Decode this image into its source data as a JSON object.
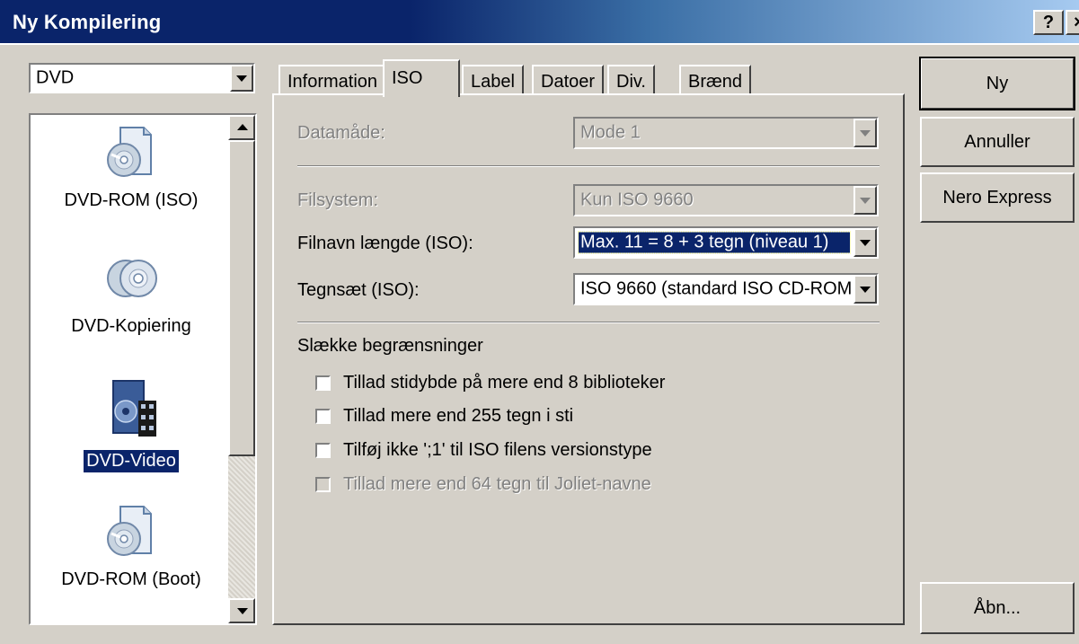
{
  "window": {
    "title": "Ny Kompilering",
    "help_button": "?",
    "close_button": "×"
  },
  "media_select": {
    "value": "DVD"
  },
  "compilation_list": {
    "items": [
      {
        "label": "DVD-ROM (ISO)",
        "icon": "dvd-rom-iso-icon",
        "selected": false
      },
      {
        "label": "DVD-Kopiering",
        "icon": "dvd-copy-icon",
        "selected": false
      },
      {
        "label": "DVD-Video",
        "icon": "dvd-video-icon",
        "selected": true
      },
      {
        "label": "DVD-ROM (Boot)",
        "icon": "dvd-rom-boot-icon",
        "selected": false
      }
    ]
  },
  "tabs": [
    {
      "label": "Information",
      "active": false
    },
    {
      "label": "ISO",
      "active": true
    },
    {
      "label": "Label",
      "active": false
    },
    {
      "label": "Datoer",
      "active": false
    },
    {
      "label": "Div.",
      "active": false
    },
    {
      "label": "Brænd",
      "active": false
    }
  ],
  "iso": {
    "data_mode": {
      "label": "Datamåde:",
      "value": "Mode 1",
      "enabled": false
    },
    "filesystem": {
      "label": "Filsystem:",
      "value": "Kun ISO 9660",
      "enabled": false
    },
    "filename_length": {
      "label": "Filnavn længde (ISO):",
      "value": "Max. 11 = 8 + 3 tegn (niveau 1)",
      "enabled": true
    },
    "charset": {
      "label": "Tegnsæt (ISO):",
      "value": "ISO 9660 (standard ISO CD-ROM",
      "enabled": true
    },
    "relax_header": "Slække begrænsninger",
    "options": [
      {
        "label": "Tillad stidybde på mere end 8 biblioteker",
        "checked": false,
        "enabled": true
      },
      {
        "label": "Tillad mere end 255 tegn i sti",
        "checked": false,
        "enabled": true
      },
      {
        "label": "Tilføj ikke ';1' til ISO filens versionstype",
        "checked": false,
        "enabled": true
      },
      {
        "label": "Tillad mere end 64 tegn til Joliet-navne",
        "checked": false,
        "enabled": false
      }
    ]
  },
  "buttons": {
    "new": "Ny",
    "cancel": "Annuller",
    "nero_express": "Nero Express",
    "open": "Åbn..."
  }
}
